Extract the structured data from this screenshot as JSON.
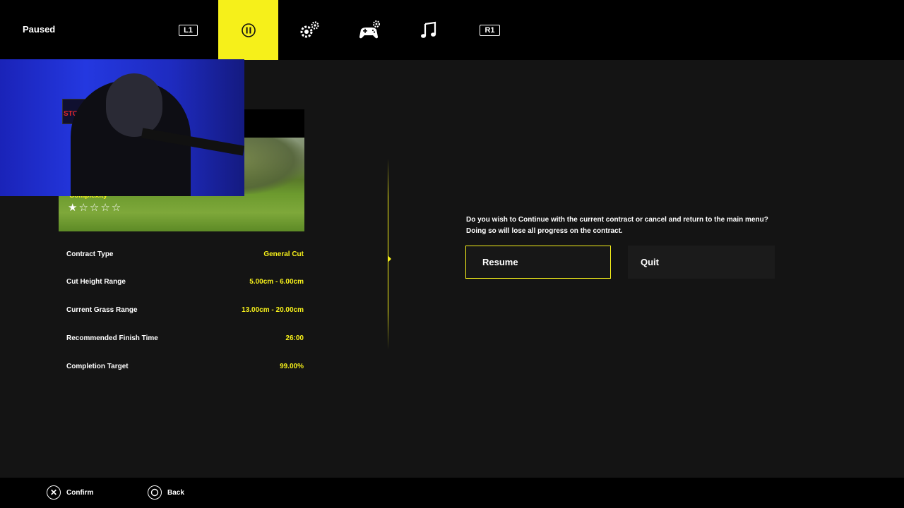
{
  "topbar": {
    "title": "Paused",
    "tabs": [
      {
        "name": "l1-shoulder",
        "label": "L1"
      },
      {
        "name": "pause",
        "icon": "pause-icon",
        "active": true
      },
      {
        "name": "settings",
        "icon": "gears-icon"
      },
      {
        "name": "controls",
        "icon": "gamepad-settings-icon"
      },
      {
        "name": "audio",
        "icon": "music-note-icon"
      },
      {
        "name": "r1-shoulder",
        "label": "R1"
      }
    ],
    "accent": "#f6f01a"
  },
  "webcam": {
    "sign_text": "STONED"
  },
  "contract": {
    "complexity_label": "Complexity",
    "complexity_stars": "★☆☆☆☆",
    "rows": [
      {
        "label": "Contract Type",
        "value": "General Cut"
      },
      {
        "label": "Cut Height Range",
        "value": "5.00cm - 6.00cm"
      },
      {
        "label": "Current Grass Range",
        "value": "13.00cm - 20.00cm"
      },
      {
        "label": "Recommended Finish Time",
        "value": "26:00"
      },
      {
        "label": "Completion Target",
        "value": "99.00%"
      }
    ]
  },
  "dialog": {
    "line1": "Do you wish to Continue with the current contract or cancel and return to the main menu?",
    "line2": "Doing so will lose all progress on the contract.",
    "resume_label": "Resume",
    "quit_label": "Quit"
  },
  "footer": {
    "confirm_label": "Confirm",
    "back_label": "Back"
  }
}
